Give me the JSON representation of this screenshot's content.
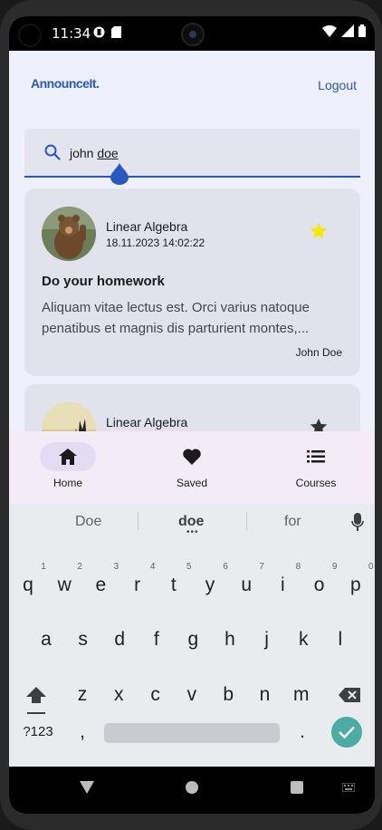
{
  "status_bar": {
    "time": "11:34"
  },
  "header": {
    "logo": "AnnounceIt.",
    "logout_label": "Logout"
  },
  "search": {
    "typed_prefix": "john ",
    "composing_word": "doe"
  },
  "announcements": [
    {
      "course": "Linear Algebra",
      "datetime": "18.11.2023 14:02:22",
      "title": "Do your homework",
      "body": "Aliquam vitae lectus est. Orci varius natoque penatibus et magnis dis parturient montes,...",
      "author": "John Doe",
      "starred": true
    },
    {
      "course": "Linear Algebra",
      "starred": true
    }
  ],
  "bottom_nav": [
    {
      "label": "Home",
      "icon": "home-icon",
      "active": true
    },
    {
      "label": "Saved",
      "icon": "heart-icon",
      "active": false
    },
    {
      "label": "Courses",
      "icon": "list-icon",
      "active": false
    }
  ],
  "keyboard": {
    "suggestions": [
      "Doe",
      "doe",
      "for"
    ],
    "row1": [
      "q",
      "w",
      "e",
      "r",
      "t",
      "y",
      "u",
      "i",
      "o",
      "p"
    ],
    "row1_hints": [
      "1",
      "2",
      "3",
      "4",
      "5",
      "6",
      "7",
      "8",
      "9",
      "0"
    ],
    "row2": [
      "a",
      "s",
      "d",
      "f",
      "g",
      "h",
      "j",
      "k",
      "l"
    ],
    "row3": [
      "z",
      "x",
      "c",
      "v",
      "b",
      "n",
      "m"
    ],
    "symbols_label": "?123",
    "comma": ",",
    "period": "."
  },
  "colors": {
    "accent": "#2a58c2",
    "star_active": "#f7e600",
    "star_inactive": "#333333",
    "enter_key": "#4aaca5"
  }
}
